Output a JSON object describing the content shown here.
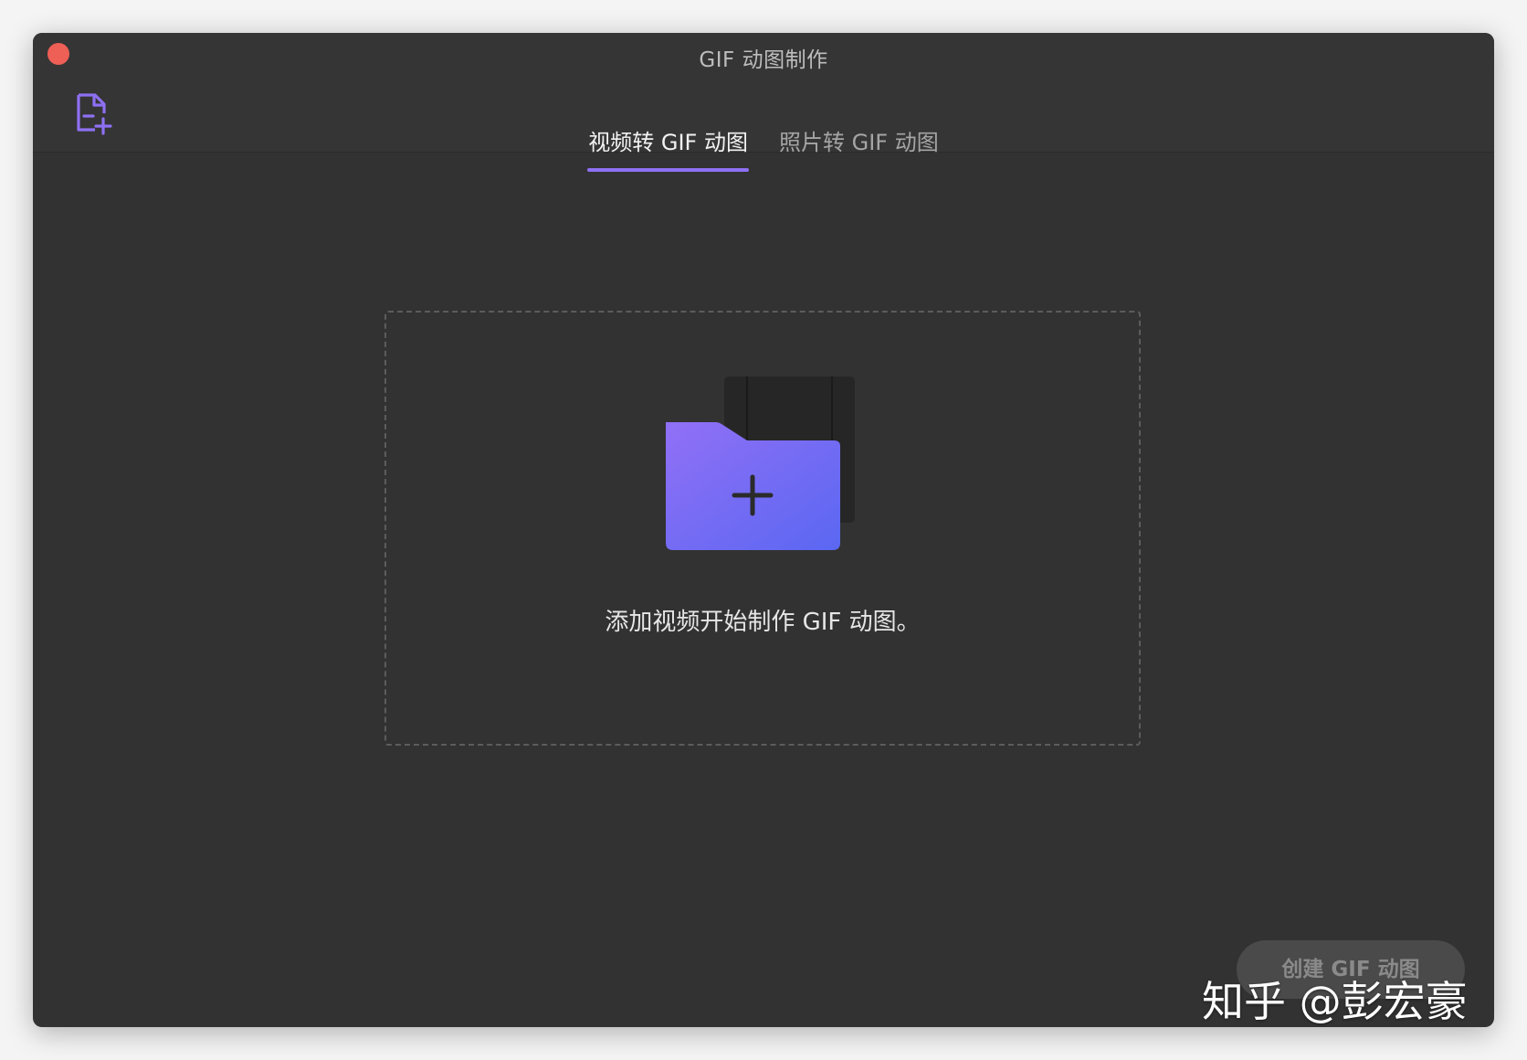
{
  "window": {
    "title": "GIF 动图制作",
    "close_color": "#ee5f56"
  },
  "toolbar": {
    "add_file_icon": "add-file-icon",
    "accent": "#8e70f3"
  },
  "tabs": [
    {
      "label": "视频转 GIF 动图",
      "active": true
    },
    {
      "label": "照片转 GIF 动图",
      "active": false
    }
  ],
  "drop_zone": {
    "icon": "add-folder-icon",
    "hint": "添加视频开始制作 GIF 动图。"
  },
  "create_button": {
    "label": "创建 GIF 动图",
    "enabled": false
  },
  "watermark": "知乎 @彭宏豪"
}
